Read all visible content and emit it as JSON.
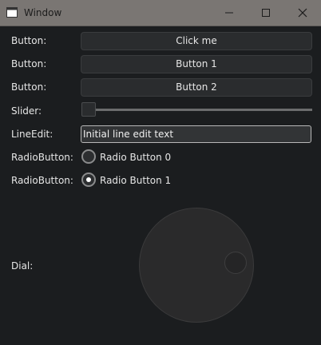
{
  "window": {
    "title": "Window"
  },
  "controls": {
    "minimize_icon": "minimize-icon",
    "maximize_icon": "maximize-icon",
    "close_icon": "close-icon"
  },
  "form": {
    "buttons": [
      {
        "label": "Button:",
        "text": "Click me"
      },
      {
        "label": "Button:",
        "text": "Button 1"
      },
      {
        "label": "Button:",
        "text": "Button 2"
      }
    ],
    "slider": {
      "label": "Slider:",
      "value_fraction": 0.0
    },
    "line_edit": {
      "label": "LineEdit:",
      "value": "Initial line edit text"
    },
    "radios": [
      {
        "label": "RadioButton:",
        "text": "Radio Button 0",
        "checked": false
      },
      {
        "label": "RadioButton:",
        "text": "Radio Button 1",
        "checked": true
      }
    ],
    "dial": {
      "label": "Dial:"
    }
  },
  "colors": {
    "titlebar": "#7a7673",
    "background": "#1b1d1f",
    "button_bg": "#2a2c2e",
    "line_edit_border": "#b8b8b8"
  }
}
